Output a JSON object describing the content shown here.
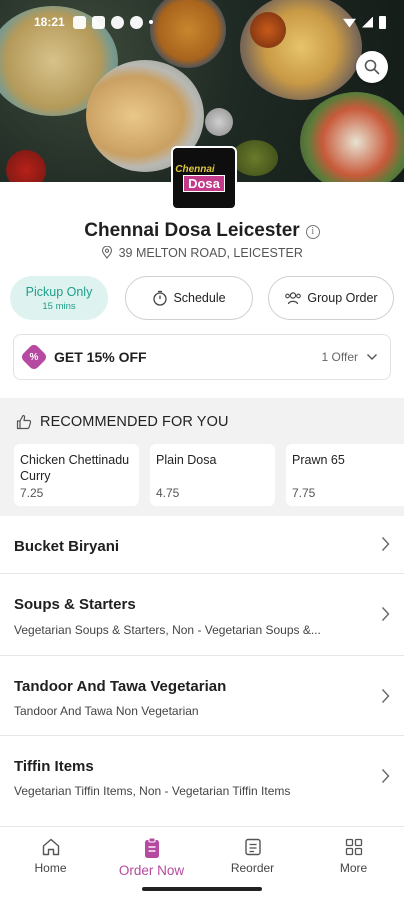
{
  "status_bar": {
    "time": "18:21"
  },
  "restaurant": {
    "name": "Chennai Dosa Leicester",
    "address": "39 MELTON ROAD, LEICESTER",
    "logo_top": "Chennai",
    "logo_main": "Dosa"
  },
  "order_options": {
    "pickup_label": "Pickup Only",
    "pickup_time": "15 mins",
    "schedule_label": "Schedule",
    "group_label": "Group Order"
  },
  "offer": {
    "badge": "%",
    "title": "GET 15% OFF",
    "count": "1 Offer"
  },
  "recommended": {
    "title": "RECOMMENDED FOR YOU",
    "items": [
      {
        "name": "Chicken Chettinadu Curry",
        "price": "7.25"
      },
      {
        "name": "Plain Dosa",
        "price": "4.75"
      },
      {
        "name": "Prawn 65",
        "price": "7.75"
      }
    ]
  },
  "categories": [
    {
      "title": "Bucket Biryani",
      "subtitle": ""
    },
    {
      "title": "Soups & Starters",
      "subtitle": "Vegetarian Soups & Starters, Non - Vegetarian Soups &..."
    },
    {
      "title": "Tandoor And Tawa Vegetarian",
      "subtitle": "Tandoor And Tawa Non Vegetarian"
    },
    {
      "title": "Tiffin Items",
      "subtitle": "Vegetarian Tiffin Items, Non - Vegetarian Tiffin Items"
    }
  ],
  "bottom_nav": [
    {
      "label": "Home",
      "icon": "home-icon"
    },
    {
      "label": "Order Now",
      "icon": "order-icon",
      "active": true
    },
    {
      "label": "Reorder",
      "icon": "reorder-icon"
    },
    {
      "label": "More",
      "icon": "grid-icon"
    }
  ],
  "colors": {
    "accent": "#b54aa0",
    "pickup_teal": "#1f9e8a",
    "pickup_bg": "#def3f0"
  }
}
